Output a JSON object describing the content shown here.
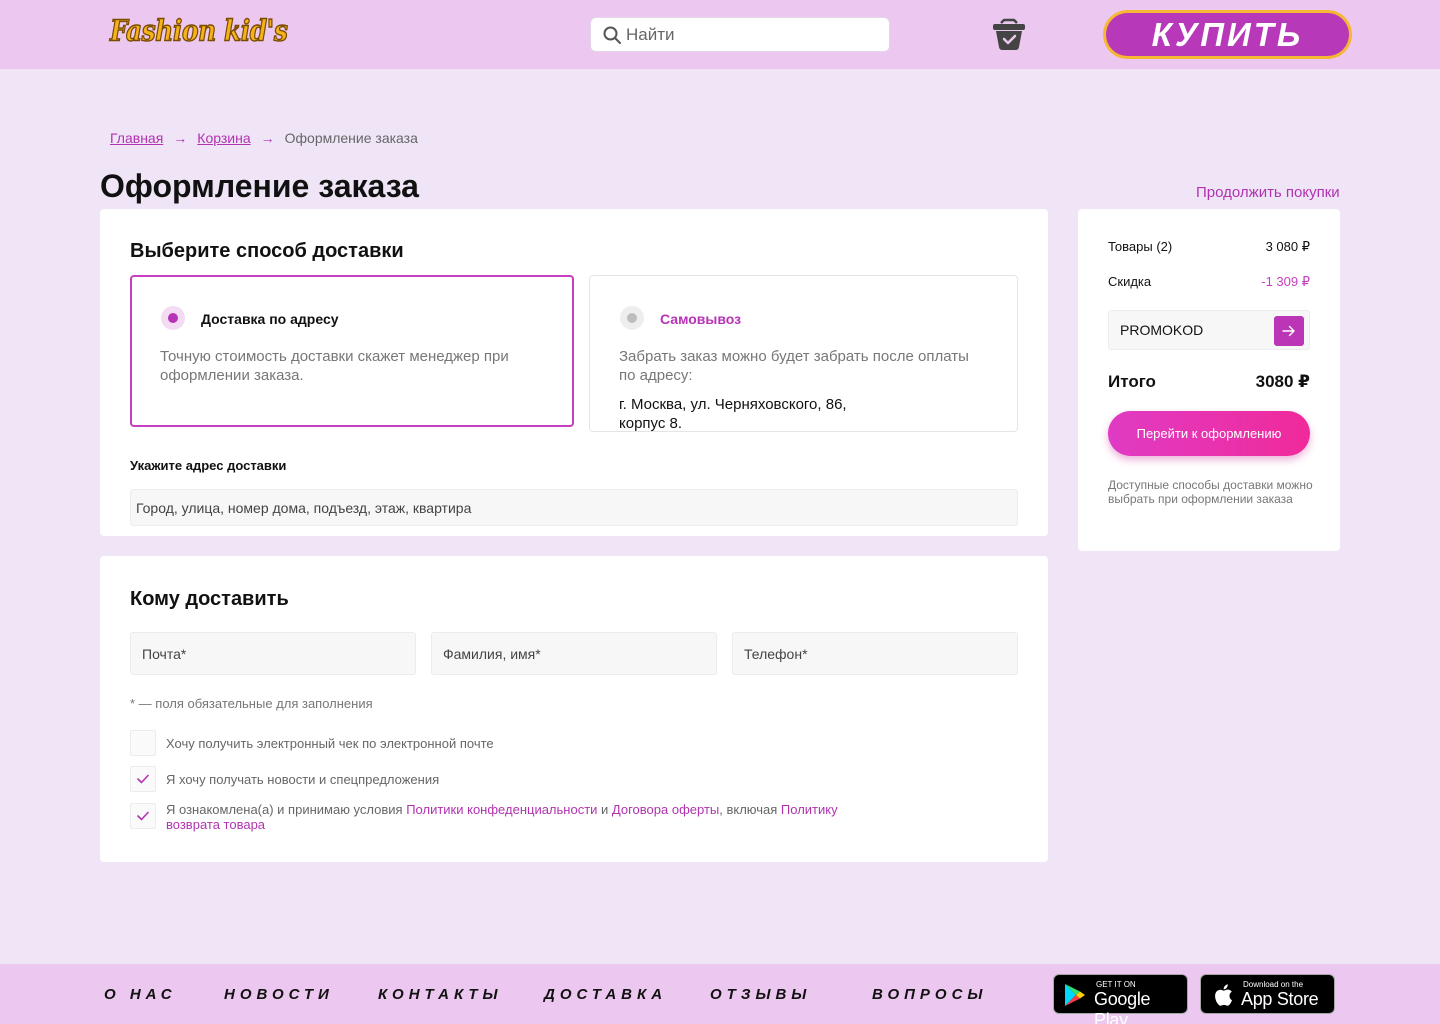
{
  "header": {
    "logo": "Fashion kid's",
    "search_placeholder": "Найти",
    "buy_label": "КУПИТЬ"
  },
  "breadcrumb": {
    "items": [
      "Главная",
      "Корзина"
    ],
    "current": "Оформление заказа"
  },
  "page": {
    "title": "Оформление заказа",
    "continue_link": "Продолжить покупки"
  },
  "delivery": {
    "title": "Выберите способ доставки",
    "options": [
      {
        "title": "Доставка по адресу",
        "description": "Точную стоимость доставки скажет менеджер при оформлении заказа.",
        "selected": true
      },
      {
        "title": "Самовывоз",
        "description": "Забрать заказ можно будет забрать после оплаты по адресу:",
        "address": "г. Москва, ул. Черняховского, 86, корпус 8.",
        "selected": false
      }
    ],
    "address_label": "Укажите адрес доставки",
    "address_placeholder": "Город, улица, номер дома, подъезд, этаж, квартира"
  },
  "recipient": {
    "title": "Кому доставить",
    "fields": [
      {
        "placeholder": "Почта*"
      },
      {
        "placeholder": "Фамилия, имя*"
      },
      {
        "placeholder": "Телефон*"
      }
    ],
    "required_note": "* — поля обязательные для заполнения",
    "checkboxes": [
      {
        "label": "Хочу получить электронный чек по электронной почте",
        "checked": false
      },
      {
        "label": "Я хочу получать новости и спецпредложения",
        "checked": true
      }
    ],
    "consent": {
      "checked": true,
      "text_1": "Я ознакомлена(а) и принимаю условия ",
      "link_1": "Политики конфеденциальности",
      "text_2": " и ",
      "link_2": "Договора оферты",
      "text_3": ", включая ",
      "link_3": "Политику возврата товара"
    }
  },
  "summary": {
    "items_label": "Товары (2)",
    "items_value": "3 080 ₽",
    "discount_label": "Скидка",
    "discount_value": "-1 309 ₽",
    "promo_placeholder": "PROMOKOD",
    "total_label": "Итого",
    "total_value": "3080 ₽",
    "checkout_label": "Перейти к оформлению",
    "note": "Доступные способы доставки можно выбрать при оформлении заказа"
  },
  "footer": {
    "links": [
      "О НАС",
      "НОВОСТИ",
      "КОНТАКТЫ",
      "ДОСТАВКА",
      "ОТЗЫВЫ",
      "ВОПРОСЫ"
    ],
    "google_small": "GET IT ON",
    "google_big": "Google Play",
    "apple_small": "Download on the",
    "apple_big": "App Store"
  },
  "colors": {
    "accent": "#b733b5",
    "header_bg": "#ecc8f0",
    "page_bg": "#efe5f7",
    "buy_border": "#f5b734",
    "discount": "#c63fbf"
  }
}
